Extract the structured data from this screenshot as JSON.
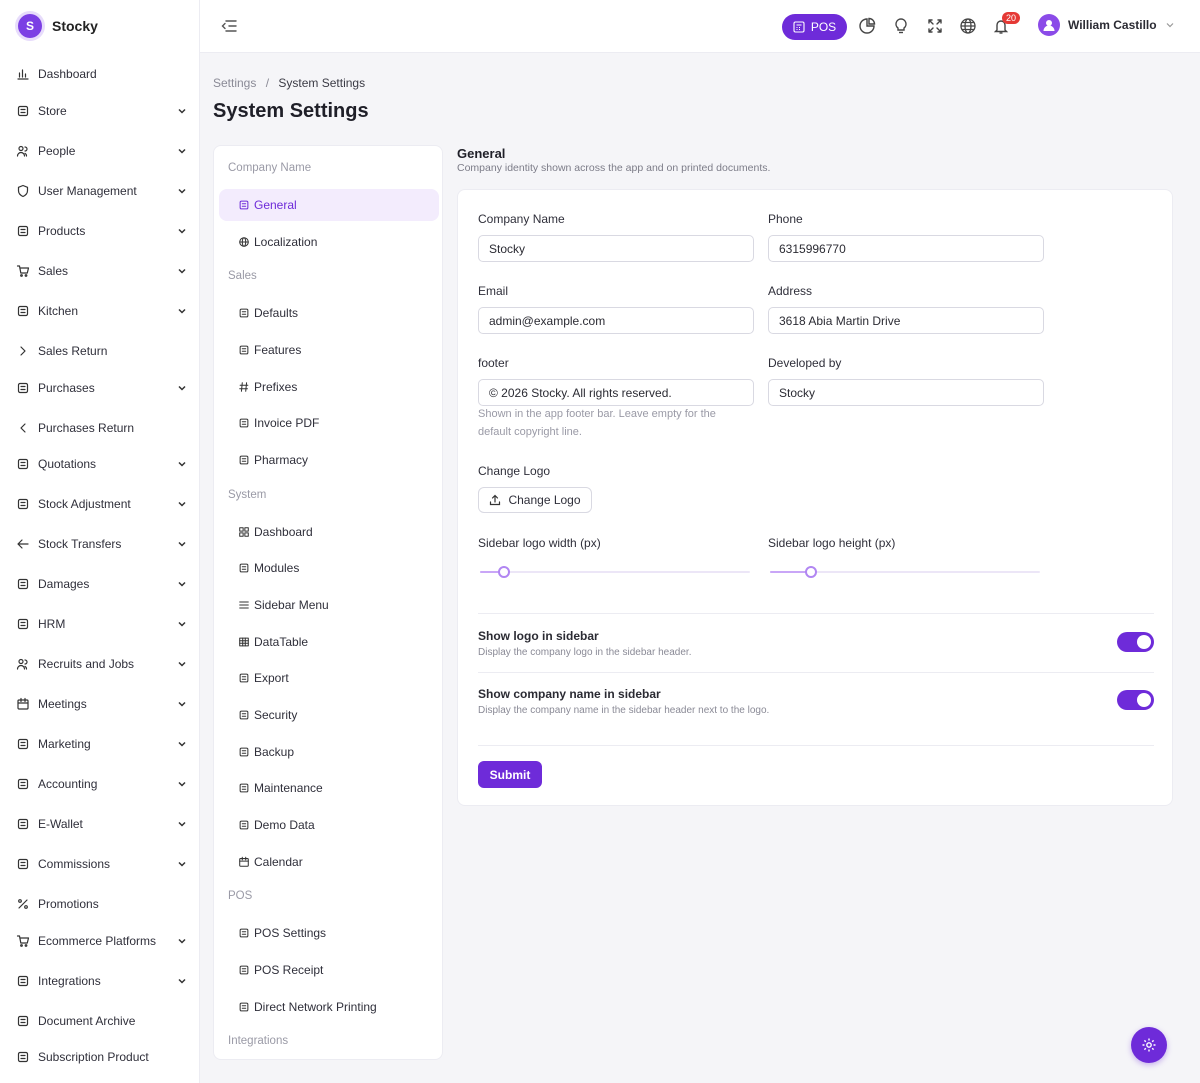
{
  "brand": {
    "logo_letter": "S",
    "name": "Stocky",
    "accent": "#6e2bd9"
  },
  "sidebar": {
    "items": [
      {
        "label": "Dashboard",
        "icon": "bar-chart-icon",
        "chevron": "none"
      },
      {
        "label": "Store",
        "icon": "store-icon",
        "chevron": "down"
      },
      {
        "label": "People",
        "icon": "users-icon",
        "chevron": "down"
      },
      {
        "label": "User Management",
        "icon": "shield-icon",
        "chevron": "down"
      },
      {
        "label": "Products",
        "icon": "books-icon",
        "chevron": "down"
      },
      {
        "label": "Sales",
        "icon": "cart-icon",
        "chevron": "down"
      },
      {
        "label": "Kitchen",
        "icon": "chef-hat-icon",
        "chevron": "down"
      },
      {
        "label": "Sales Return",
        "icon": "chevron-right-icon",
        "chevron": "none"
      },
      {
        "label": "Purchases",
        "icon": "receipt-icon",
        "chevron": "down"
      },
      {
        "label": "Purchases Return",
        "icon": "chevron-left-icon",
        "chevron": "none"
      },
      {
        "label": "Quotations",
        "icon": "basket-icon",
        "chevron": "down"
      },
      {
        "label": "Stock Adjustment",
        "icon": "pin-icon",
        "chevron": "down"
      },
      {
        "label": "Stock Transfers",
        "icon": "arrow-left-icon",
        "chevron": "down"
      },
      {
        "label": "Damages",
        "icon": "bag-icon",
        "chevron": "down"
      },
      {
        "label": "HRM",
        "icon": "library-icon",
        "chevron": "down"
      },
      {
        "label": "Recruits and Jobs",
        "icon": "users-icon",
        "chevron": "down"
      },
      {
        "label": "Meetings",
        "icon": "calendar-icon",
        "chevron": "down"
      },
      {
        "label": "Marketing",
        "icon": "megaphone-icon",
        "chevron": "down"
      },
      {
        "label": "Accounting",
        "icon": "wallet-icon",
        "chevron": "down"
      },
      {
        "label": "E-Wallet",
        "icon": "wallet-icon",
        "chevron": "down"
      },
      {
        "label": "Commissions",
        "icon": "wallet-icon",
        "chevron": "down"
      },
      {
        "label": "Promotions",
        "icon": "percent-icon",
        "chevron": "none"
      },
      {
        "label": "Ecommerce Platforms",
        "icon": "cart-icon",
        "chevron": "down"
      },
      {
        "label": "Integrations",
        "icon": "plug-icon",
        "chevron": "down"
      },
      {
        "label": "Document Archive",
        "icon": "folder-icon",
        "chevron": "none"
      },
      {
        "label": "Subscription Product",
        "icon": "dollar-icon",
        "chevron": "none"
      }
    ]
  },
  "topbar": {
    "pos_label": "POS",
    "notification_count": "20",
    "user_name": "William Castillo"
  },
  "breadcrumb": {
    "parent": "Settings",
    "sep": "/",
    "current": "System Settings"
  },
  "page_title": "System Settings",
  "settings_menu": {
    "groups": [
      {
        "label": "Company Name",
        "items": [
          {
            "label": "General",
            "icon": "building-icon",
            "active": true
          },
          {
            "label": "Localization",
            "icon": "globe-icon",
            "active": false
          }
        ]
      },
      {
        "label": "Sales",
        "items": [
          {
            "label": "Defaults",
            "icon": "sliders-icon",
            "active": false
          },
          {
            "label": "Features",
            "icon": "bolt-icon",
            "active": false
          },
          {
            "label": "Prefixes",
            "icon": "hash-icon",
            "active": false
          },
          {
            "label": "Invoice PDF",
            "icon": "pdf-icon",
            "active": false
          },
          {
            "label": "Pharmacy",
            "icon": "medkit-icon",
            "active": false
          }
        ]
      },
      {
        "label": "System",
        "items": [
          {
            "label": "Dashboard",
            "icon": "grid-icon",
            "active": false
          },
          {
            "label": "Modules",
            "icon": "modules-icon",
            "active": false
          },
          {
            "label": "Sidebar Menu",
            "icon": "list-icon",
            "active": false
          },
          {
            "label": "DataTable",
            "icon": "table-icon",
            "active": false
          },
          {
            "label": "Export",
            "icon": "export-icon",
            "active": false
          },
          {
            "label": "Security",
            "icon": "shield-check-icon",
            "active": false
          },
          {
            "label": "Backup",
            "icon": "cloud-upload-icon",
            "active": false
          },
          {
            "label": "Maintenance",
            "icon": "wrench-icon",
            "active": false
          },
          {
            "label": "Demo Data",
            "icon": "flask-icon",
            "active": false
          },
          {
            "label": "Calendar",
            "icon": "calendar-icon",
            "active": false
          }
        ]
      },
      {
        "label": "POS",
        "items": [
          {
            "label": "POS Settings",
            "icon": "sliders-icon",
            "active": false
          },
          {
            "label": "POS Receipt",
            "icon": "receipt-icon",
            "active": false
          },
          {
            "label": "Direct Network Printing",
            "icon": "printer-icon",
            "active": false
          }
        ]
      },
      {
        "label": "Integrations",
        "items": []
      }
    ]
  },
  "general": {
    "title": "General",
    "subtitle": "Company identity shown across the app and on printed documents.",
    "company_name": {
      "label": "Company Name",
      "value": "Stocky"
    },
    "phone": {
      "label": "Phone",
      "value": "6315996770"
    },
    "email": {
      "label": "Email",
      "value": "admin@example.com"
    },
    "address": {
      "label": "Address",
      "value": "3618 Abia Martin Drive"
    },
    "footer": {
      "label": "footer",
      "value": "© 2026 Stocky. All rights reserved.",
      "help": "Shown in the app footer bar. Leave empty for the default copyright line."
    },
    "developed_by": {
      "label": "Developed by",
      "value": "Stocky"
    },
    "change_logo": {
      "label": "Change Logo",
      "button": "Change Logo"
    },
    "logo_width": {
      "label": "Sidebar logo width (px)",
      "level": 0.09
    },
    "logo_height": {
      "label": "Sidebar logo height (px)",
      "level": 0.15
    },
    "show_logo": {
      "title": "Show logo in sidebar",
      "desc": "Display the company logo in the sidebar header.",
      "on": true
    },
    "show_name": {
      "title": "Show company name in sidebar",
      "desc": "Display the company name in the sidebar header next to the logo.",
      "on": true
    },
    "submit": "Submit"
  }
}
